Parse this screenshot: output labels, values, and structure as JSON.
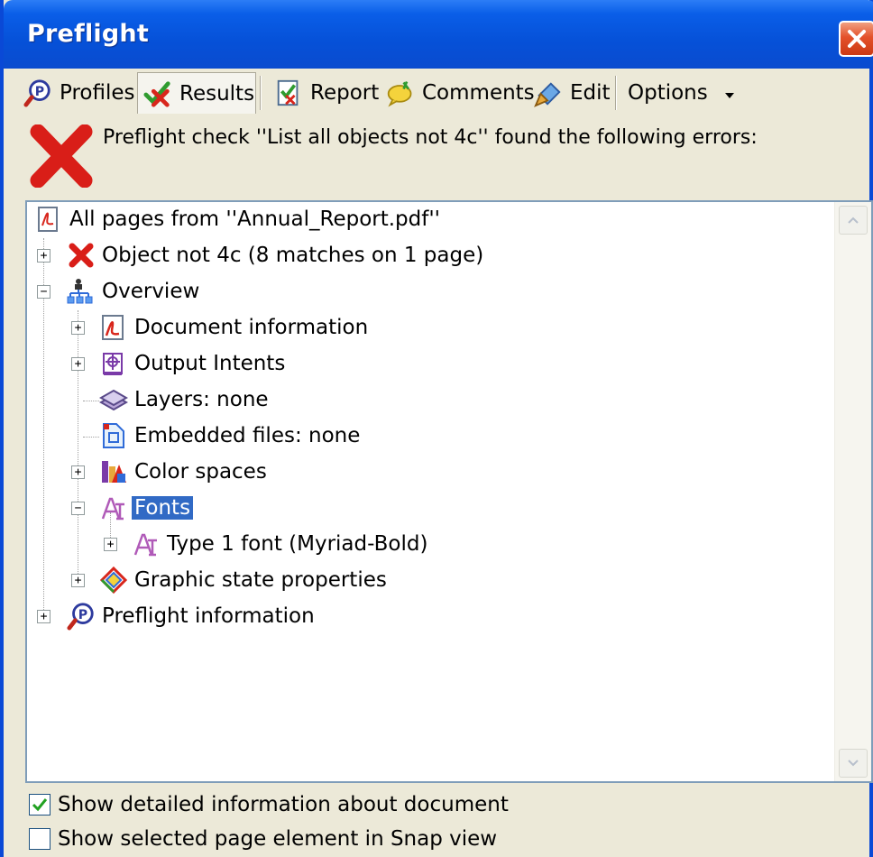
{
  "window": {
    "title": "Preflight"
  },
  "toolbar": {
    "profiles": "Profiles",
    "results": "Results",
    "report": "Report",
    "comments": "Comments",
    "edit": "Edit",
    "options": "Options"
  },
  "message": "Preflight check ''List all objects not 4c'' found the following errors:",
  "tree": {
    "root": "All pages from ''Annual_Report.pdf''",
    "object_not_4c": "Object not 4c (8 matches on 1 page)",
    "overview": "Overview",
    "document_information": "Document information",
    "output_intents": "Output Intents",
    "layers": "Layers: none",
    "embedded_files": "Embedded files: none",
    "color_spaces": "Color spaces",
    "fonts": "Fonts",
    "type1_font": "Type 1 font (Myriad-Bold)",
    "graphic_state": "Graphic state properties",
    "preflight_information": "Preflight information",
    "selected_item": "Fonts"
  },
  "options": {
    "show_detailed": {
      "label": "Show detailed information about document",
      "checked": true
    },
    "show_snap": {
      "label": "Show selected page element in Snap view",
      "checked": false
    }
  }
}
